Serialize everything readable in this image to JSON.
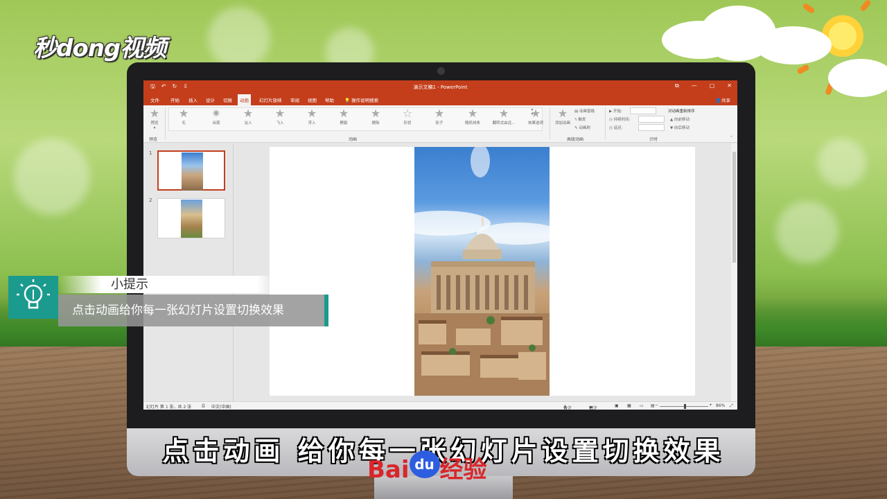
{
  "logo": {
    "text": "秒dong视频"
  },
  "app": {
    "window_title": "演示文稿1 - PowerPoint",
    "qat": [
      "🖫",
      "↶",
      "↻",
      "⇩"
    ],
    "window_controls": [
      "⧉",
      "—",
      "▢",
      "✕"
    ],
    "tabs": [
      "文件",
      "开始",
      "插入",
      "设计",
      "切换",
      "动画",
      "幻灯片放映",
      "审阅",
      "视图",
      "帮助"
    ],
    "active_tab": "动画",
    "tell_me": "操作说明搜索",
    "share": "共享"
  },
  "ribbon": {
    "preview": {
      "label": "预览",
      "group": "预览"
    },
    "animations": [
      "无",
      "出现",
      "淡入",
      "飞入",
      "浮入",
      "劈裂",
      "擦除",
      "形状",
      "轮子",
      "随机线条",
      "翻转式由远..."
    ],
    "effect_options": "效果选项",
    "animation_group": "动画",
    "add_animation": "添加动画",
    "animation_pane": "动画窗格",
    "trigger": "触发",
    "animation_painter": "动画刷",
    "advanced_group": "高级动画",
    "start_label": "开始:",
    "duration_label": "持续时间:",
    "delay_label": "延迟:",
    "reorder_title": "对动画重新排序",
    "move_earlier": "向前移动",
    "move_later": "向后移动",
    "timing_group": "计时"
  },
  "thumbnails": [
    {
      "num": "1",
      "selected": true
    },
    {
      "num": "2",
      "selected": false
    }
  ],
  "statusbar": {
    "slide_info": "幻灯片 第 1 张，共 2 张",
    "language": "中文(中国)",
    "notes": "备注",
    "comments": "批注",
    "zoom": "86%"
  },
  "tip": {
    "title": "小提示",
    "body": "点击动画给你每一张幻灯片设置切换效果"
  },
  "subtitle": "点击动画 给你每一张幻灯片设置切换效果",
  "watermark": {
    "part1": "Bai",
    "part2": "du",
    "part3": "经验"
  }
}
